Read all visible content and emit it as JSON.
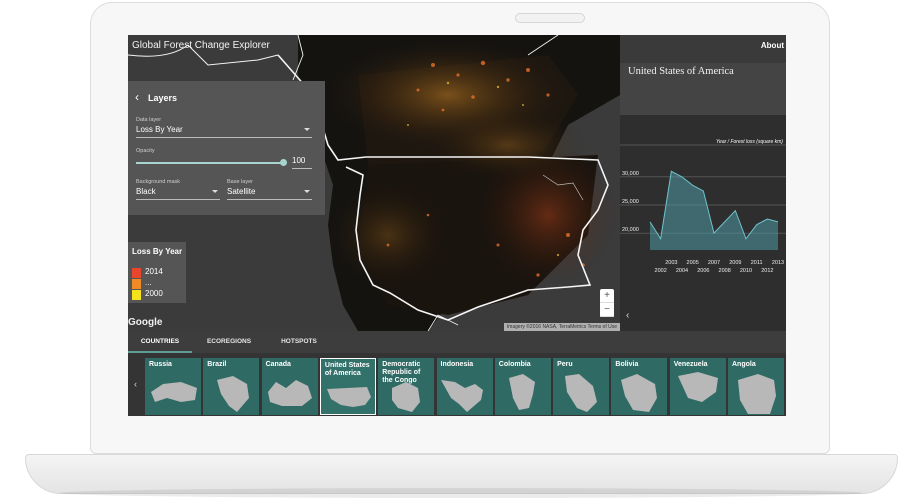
{
  "app": {
    "title": "Global Forest Change Explorer"
  },
  "map": {
    "google_logo": "Google",
    "attribution": "Imagery ©2016 NASA, TerraMetrics   Terms of Use",
    "zoom_in": "+",
    "zoom_out": "−"
  },
  "layers_panel": {
    "back_icon": "‹",
    "header": "Layers",
    "data_layer_label": "Data layer",
    "data_layer_value": "Loss By Year",
    "opacity_label": "Opacity",
    "opacity_value": "100",
    "background_mask_label": "Background mask",
    "background_mask_value": "Black",
    "base_layer_label": "Base layer",
    "base_layer_value": "Satellite"
  },
  "legend": {
    "title": "Loss By Year",
    "items": [
      {
        "label": "2014",
        "color": "#e8452c"
      },
      {
        "label": "...",
        "color": "#f08a24"
      },
      {
        "label": "2000",
        "color": "#f6e21c"
      }
    ]
  },
  "right_panel": {
    "about": "About",
    "country": "United States of America",
    "back_icon": "‹",
    "chart_title": "Year / Forest loss (square km)"
  },
  "chart_data": {
    "type": "area",
    "title": "Year / Forest loss (square km)",
    "x": [
      2001,
      2002,
      2003,
      2004,
      2005,
      2006,
      2007,
      2008,
      2009,
      2010,
      2011,
      2012,
      2013
    ],
    "y": [
      22000,
      19000,
      31000,
      30000,
      28500,
      27500,
      20000,
      22000,
      24000,
      19000,
      21500,
      22500,
      22000
    ],
    "y_ticks": [
      "30,000",
      "25,000",
      "20,000"
    ],
    "x_ticks_top": [
      "2003",
      "2005",
      "2007",
      "2009",
      "2011",
      "2013"
    ],
    "x_ticks_bottom": [
      "2002",
      "2004",
      "2006",
      "2008",
      "2010",
      "2012"
    ],
    "ylim": [
      17000,
      33000
    ],
    "color": "#4e9ba5"
  },
  "bottom": {
    "tabs": [
      {
        "label": "COUNTRIES",
        "active": true
      },
      {
        "label": "ECOREGIONS",
        "active": false
      },
      {
        "label": "HOTSPOTS",
        "active": false
      }
    ],
    "left_arrow": "‹",
    "countries": [
      {
        "name": "Russia"
      },
      {
        "name": "Brazil"
      },
      {
        "name": "Canada"
      },
      {
        "name": "United States of America",
        "selected": true
      },
      {
        "name": "Democratic Republic of the Congo"
      },
      {
        "name": "Indonesia"
      },
      {
        "name": "Colombia"
      },
      {
        "name": "Peru"
      },
      {
        "name": "Bolivia"
      },
      {
        "name": "Venezuela"
      },
      {
        "name": "Angola"
      }
    ]
  }
}
